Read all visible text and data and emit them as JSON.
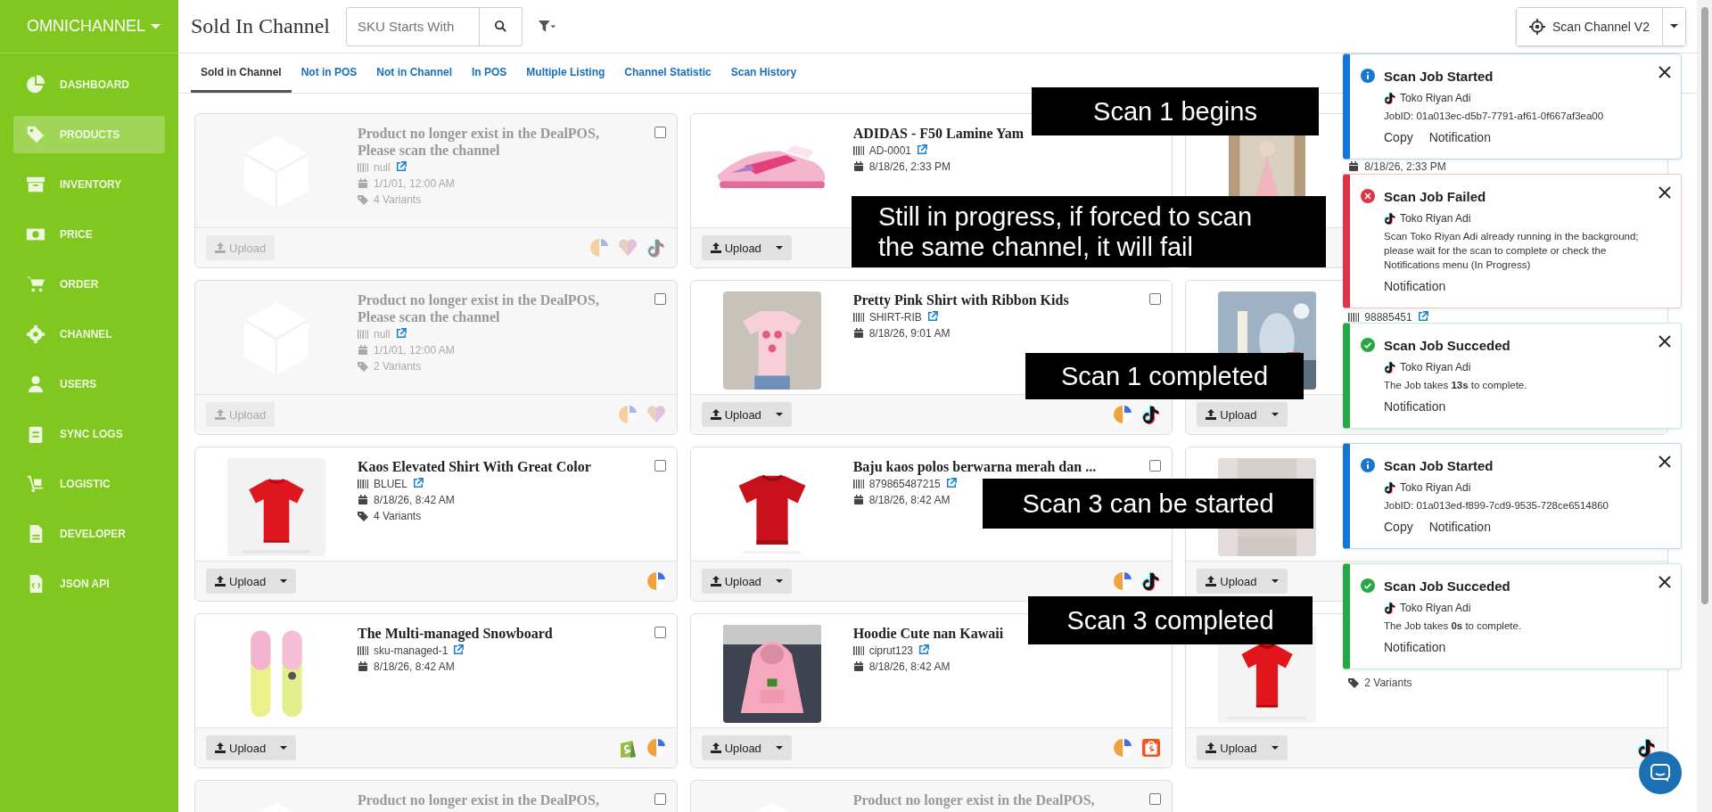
{
  "sidebar": {
    "brand": "OMNICHANNEL",
    "items": [
      {
        "label": "DASHBOARD",
        "selected": false
      },
      {
        "label": "PRODUCTS",
        "selected": true
      },
      {
        "label": "INVENTORY",
        "selected": false
      },
      {
        "label": "PRICE",
        "selected": false
      },
      {
        "label": "ORDER",
        "selected": false
      },
      {
        "label": "CHANNEL",
        "selected": false
      },
      {
        "label": "USERS",
        "selected": false
      },
      {
        "label": "SYNC LOGS",
        "selected": false
      },
      {
        "label": "LOGISTIC",
        "selected": false
      },
      {
        "label": "DEVELOPER",
        "selected": false
      },
      {
        "label": "JSON API",
        "selected": false
      }
    ]
  },
  "header": {
    "title": "Sold In Channel",
    "search": {
      "placeholder": "SKU Starts With"
    },
    "scan_button": "Scan Channel V2"
  },
  "tabs": [
    {
      "label": "Sold in Channel",
      "selected": true
    },
    {
      "label": "Not in POS",
      "selected": false
    },
    {
      "label": "Not in Channel",
      "selected": false
    },
    {
      "label": "In POS",
      "selected": false
    },
    {
      "label": "Multiple Listing",
      "selected": false
    },
    {
      "label": "Channel Statistic",
      "selected": false
    },
    {
      "label": "Scan History",
      "selected": false
    }
  ],
  "cards": [
    {
      "kind": "missing",
      "title": "Product no longer exist in the DealPOS, Please scan the channel",
      "sku": "null",
      "date": "1/1/01, 12:00 AM",
      "variants": "4 Variants",
      "checked": false,
      "upload": "Upload",
      "channels": [
        {
          "kind": "pie"
        },
        {
          "kind": "heart"
        },
        {
          "kind": "note"
        }
      ]
    },
    {
      "kind": "product",
      "image": {
        "kind": "picture"
      },
      "title": "ADIDAS - F50 Lamine Yam",
      "sku": "AD-0001",
      "date": "8/18/26, 2:33 PM",
      "upload": "Upload"
    },
    {
      "kind": "product",
      "image": {
        "kind": "picture"
      },
      "date": "8/18/26, 2:33 PM"
    },
    {
      "kind": "missing",
      "title": "Product no longer exist in the DealPOS, Please scan the channel",
      "sku": "null",
      "date": "1/1/01, 12:00 AM",
      "variants": "2 Variants",
      "checked": false,
      "upload": "Upload",
      "channels": [
        {
          "kind": "pie"
        },
        {
          "kind": "heart"
        }
      ]
    },
    {
      "kind": "product",
      "image": {
        "kind": "picture"
      },
      "title": "Pretty Pink Shirt with Ribbon Kids",
      "sku": "SHIRT-RIB",
      "date": "8/18/26, 9:01 AM",
      "checked": false,
      "upload": "Upload",
      "channels": [
        {
          "kind": "pie"
        },
        {
          "kind": "note"
        }
      ]
    },
    {
      "kind": "product",
      "image": {
        "kind": "picture"
      },
      "sku": "98885451",
      "upload": "Upload"
    },
    {
      "kind": "product",
      "image": {
        "kind": "picture"
      },
      "title": "Kaos Elevated Shirt With Great Color",
      "sku": "BLUEL",
      "date": "8/18/26, 8:42 AM",
      "variants": "4 Variants",
      "checked": false,
      "upload": "Upload",
      "channels": [
        {
          "kind": "pie"
        }
      ]
    },
    {
      "kind": "product",
      "image": {
        "kind": "picture"
      },
      "title": "Baju kaos polos berwarna merah dan ...",
      "sku": "879865487215",
      "date": "8/18/26, 8:42 AM",
      "checked": false,
      "upload": "Upload",
      "channels": [
        {
          "kind": "pie"
        },
        {
          "kind": "note"
        }
      ]
    },
    {
      "kind": "product",
      "image": {
        "kind": "picture"
      },
      "upload": "Upload"
    },
    {
      "kind": "product",
      "image": {
        "kind": "picture"
      },
      "title": "The Multi-managed Snowboard",
      "sku": "sku-managed-1",
      "date": "8/18/26, 8:42 AM",
      "checked": false,
      "upload": "Upload",
      "channels": [
        {
          "kind": "bag"
        },
        {
          "kind": "pie"
        }
      ]
    },
    {
      "kind": "product",
      "image": {
        "kind": "picture"
      },
      "title": "Hoodie Cute nan Kawaii",
      "sku": "ciprut123",
      "date": "8/18/26, 8:42 AM",
      "upload": "Upload",
      "channels": [
        {
          "kind": "pie"
        },
        {
          "kind": "shop"
        }
      ]
    },
    {
      "kind": "product",
      "image": {
        "kind": "picture"
      },
      "variants": "2 Variants",
      "upload": "Upload",
      "channels": [
        {
          "kind": "note"
        }
      ]
    },
    {
      "kind": "missing",
      "title": "Product no longer exist in the DealPOS,",
      "checked": false
    },
    {
      "kind": "missing",
      "title": "Product no longer exist in the DealPOS,",
      "checked": false
    }
  ],
  "annotations": [
    "Scan 1 begins",
    "Still in progress, if forced to scan the same channel, it will fail",
    "Scan 1 completed",
    "Scan 3 can be started",
    "Scan 3 completed"
  ],
  "toasts": [
    {
      "kind": "info",
      "title": "Scan Job Started",
      "channel": "Toko Riyan Adi",
      "body": "JobID: 01a013ec-d5b7-7791-af61-0f667af3ea00",
      "actions": [
        "Copy",
        "Notification"
      ]
    },
    {
      "kind": "error",
      "title": "Scan Job Failed",
      "channel": "Toko Riyan Adi",
      "body": "Scan Toko Riyan Adi already running in the background; please wait for the scan to complete or check the Notifications menu (In Progress)",
      "actions": [
        "Notification"
      ]
    },
    {
      "kind": "success",
      "title": "Scan Job Succeded",
      "channel": "Toko Riyan Adi",
      "body": "The Job takes **13s** to complete.",
      "actions": [
        "Notification"
      ]
    },
    {
      "kind": "info",
      "title": "Scan Job Started",
      "channel": "Toko Riyan Adi",
      "body": "JobID: 01a013ed-f899-7cd9-9535-728ce6514860",
      "actions": [
        "Copy",
        "Notification"
      ]
    },
    {
      "kind": "success",
      "title": "Scan Job Succeded",
      "channel": "Toko Riyan Adi",
      "body": "The Job takes **0s** to complete.",
      "actions": [
        "Notification"
      ]
    }
  ]
}
